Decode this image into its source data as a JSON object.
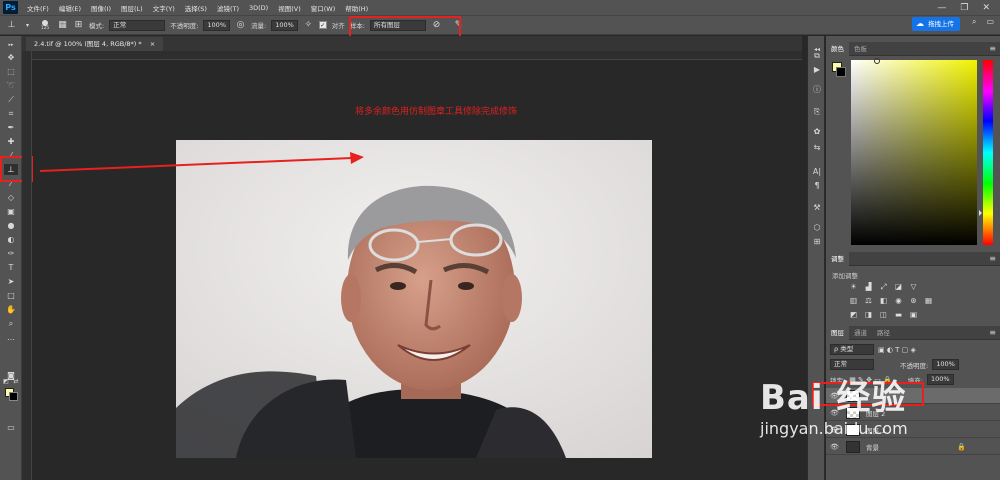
{
  "app": {
    "logo": "Ps",
    "window_controls": [
      "—",
      "❐",
      "✕"
    ]
  },
  "menu": [
    "文件(F)",
    "编辑(E)",
    "图像(I)",
    "图层(L)",
    "文字(Y)",
    "选择(S)",
    "滤镜(T)",
    "3D(D)",
    "视图(V)",
    "窗口(W)",
    "帮助(H)"
  ],
  "options": {
    "brush_size": "125",
    "mode_label": "模式:",
    "mode_value": "正常",
    "opacity_label": "不透明度:",
    "opacity_value": "100%",
    "flow_label": "流量:",
    "flow_value": "100%",
    "aligned_label": "对齐",
    "sample_label": "样本:",
    "sample_value": "所有图层"
  },
  "share_button": "拖拽上传",
  "document_tab": "2.4.tif @ 100% (图层 4, RGB/8*) *",
  "annotation": "将多余颜色用仿制图章工具修除完成修饰",
  "panels": {
    "color_tabs": [
      "颜色",
      "色板"
    ],
    "adjust_tab": "调整",
    "adjust_add": "添加调整",
    "layers_tabs": [
      "图层",
      "通道",
      "路径"
    ],
    "layer_filter": "ρ 类型",
    "blend_mode": "正常",
    "layer_opacity_label": "不透明度:",
    "layer_opacity_value": "100%",
    "lock_label": "锁定:",
    "fill_label": "填充:",
    "fill_value": "100%",
    "layers": [
      {
        "name": ""
      },
      {
        "name": "图层 2"
      },
      {
        "name": "图层 1"
      },
      {
        "name": "背景"
      }
    ]
  },
  "watermark": {
    "main": "Bai 经验",
    "sub": "jingyan.baidu.com"
  },
  "colors": {
    "foreground": "#fffaa8",
    "background": "#000000",
    "highlight": "#e8201e"
  }
}
